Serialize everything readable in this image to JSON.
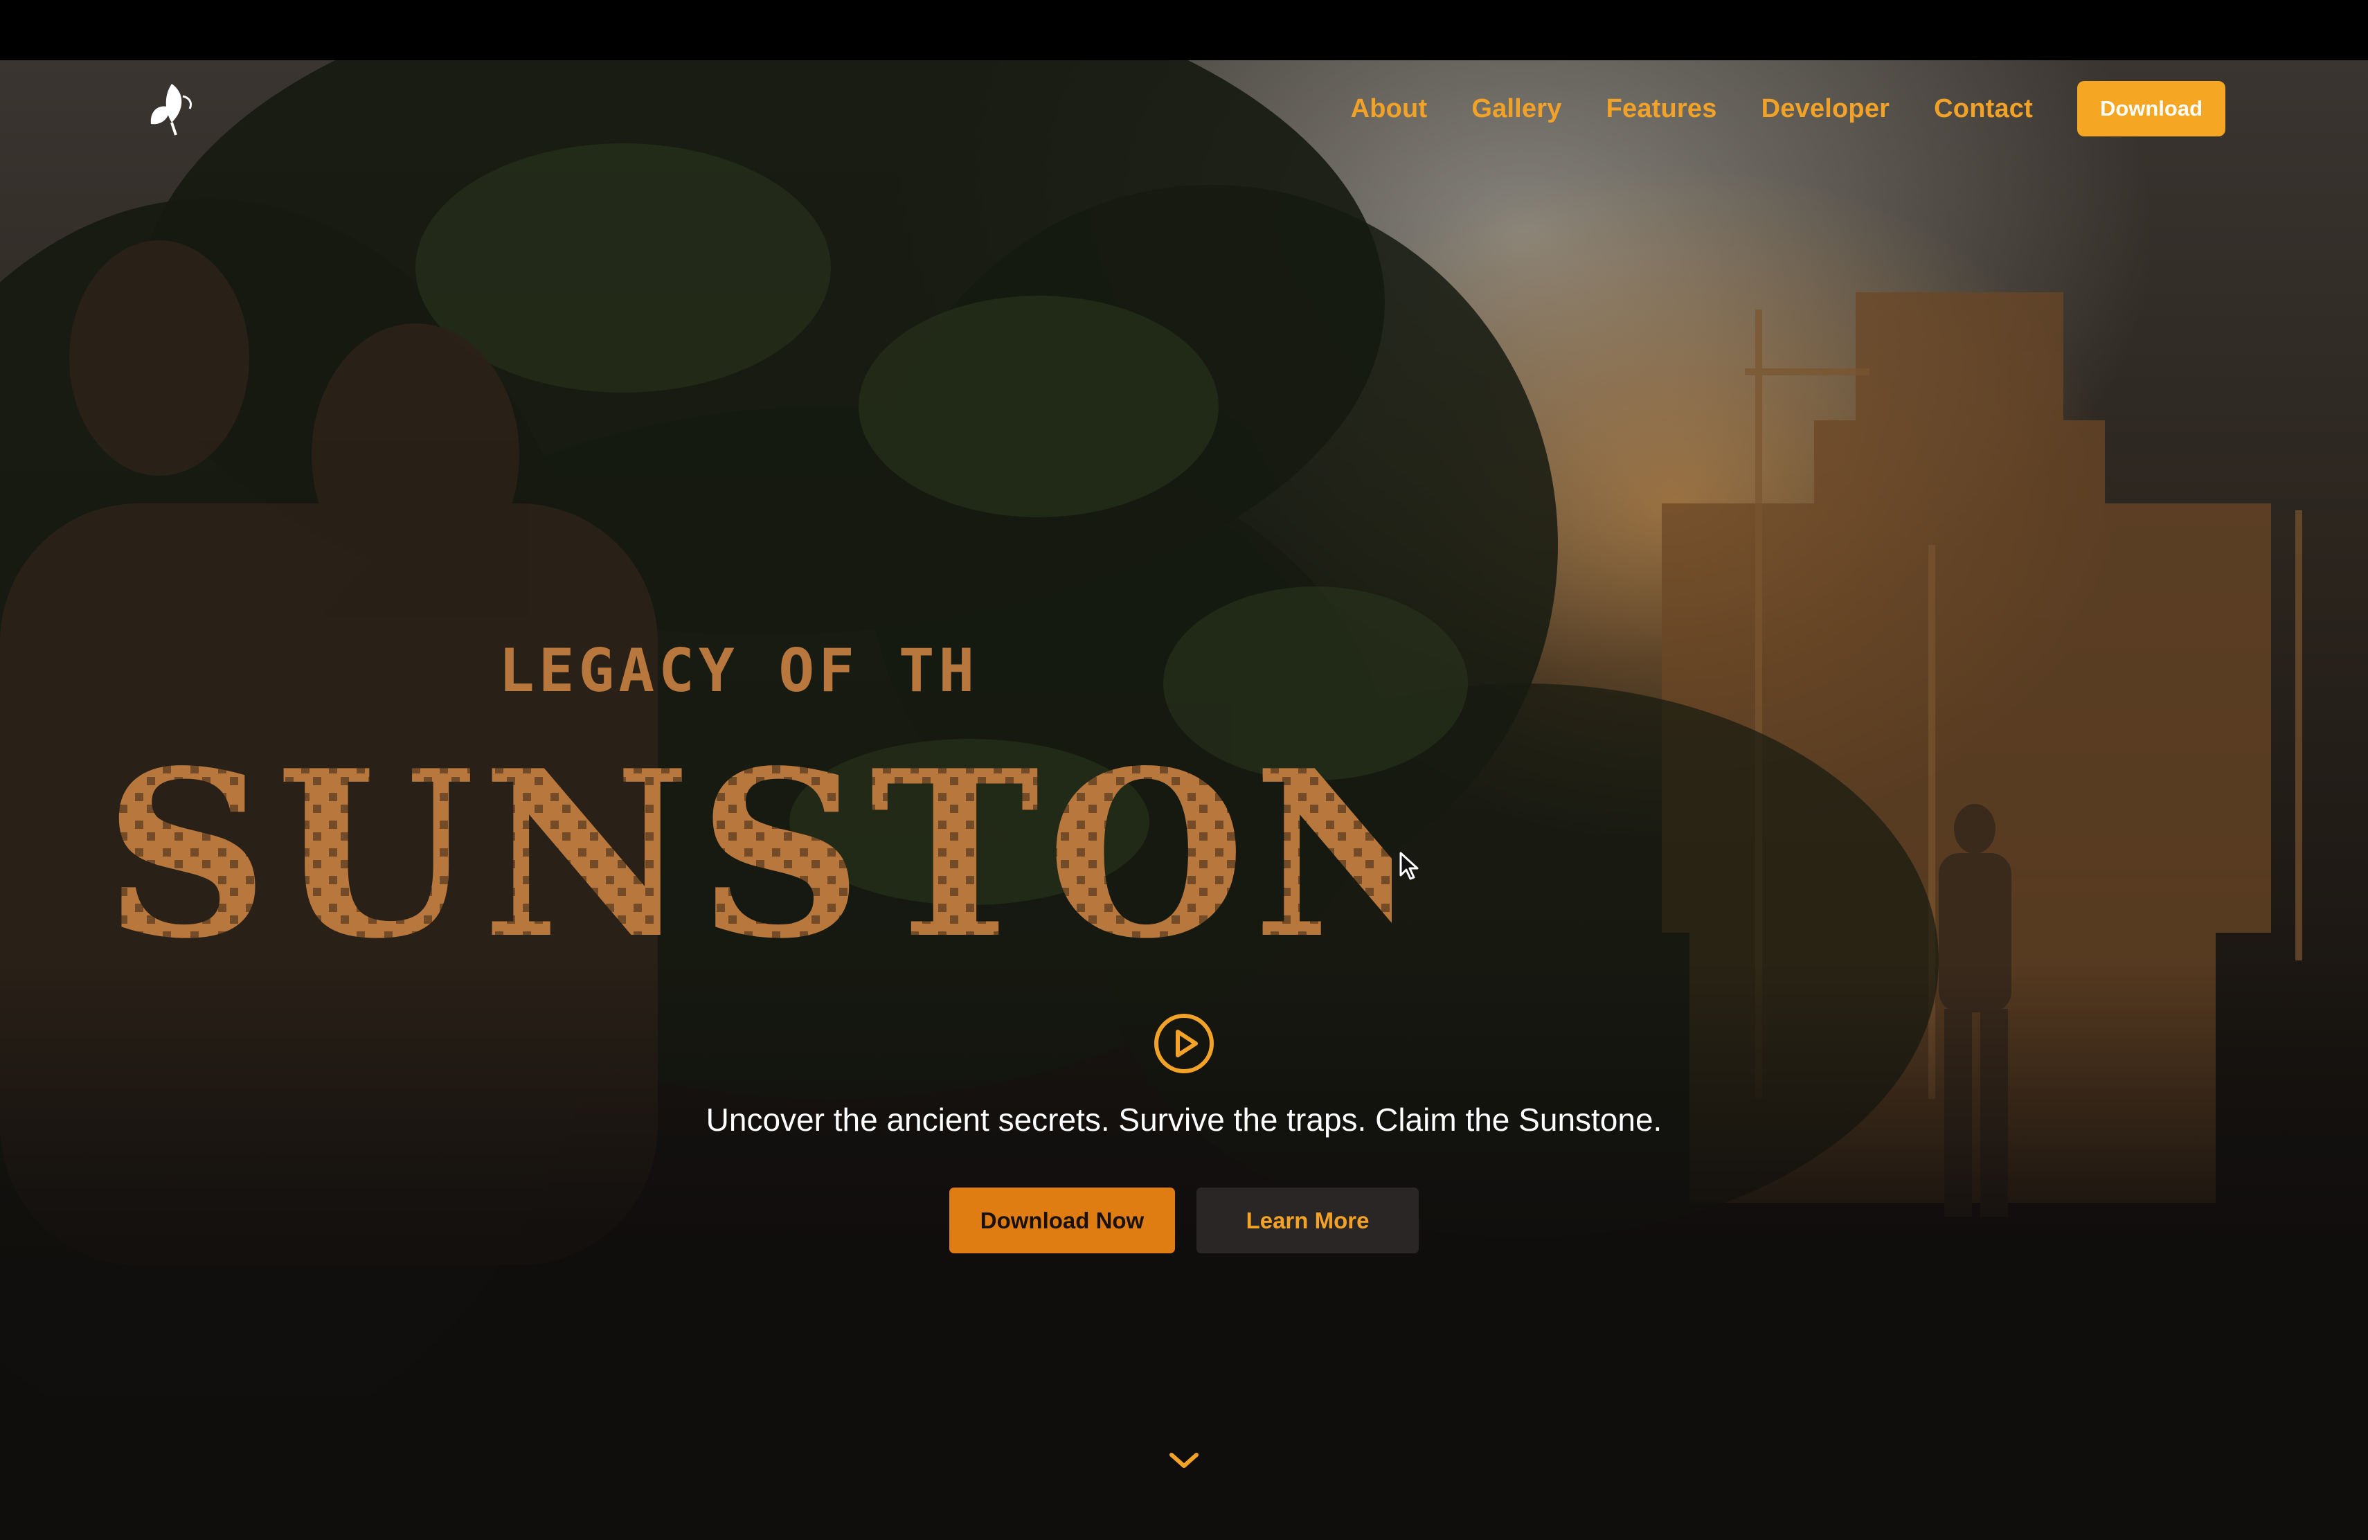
{
  "nav": {
    "logo_name": "leaf-logo",
    "links": [
      {
        "label": "About"
      },
      {
        "label": "Gallery"
      },
      {
        "label": "Features"
      },
      {
        "label": "Developer"
      },
      {
        "label": "Contact"
      }
    ],
    "download_label": "Download"
  },
  "hero": {
    "title_top": "LEGACY OF THE",
    "title_main": "SUNSTONE",
    "tagline": "Uncover the ancient secrets. Survive the traps. Claim the Sunstone.",
    "primary_button": "Download Now",
    "secondary_button": "Learn More",
    "play_icon": "play-circle-icon",
    "scroll_icon": "chevron-down-icon"
  },
  "colors": {
    "accent": "#f2a327",
    "button_primary": "#df7c12",
    "button_secondary_bg": "#2c2828",
    "title_fill": "#b8773c",
    "background": "#100e0d"
  }
}
